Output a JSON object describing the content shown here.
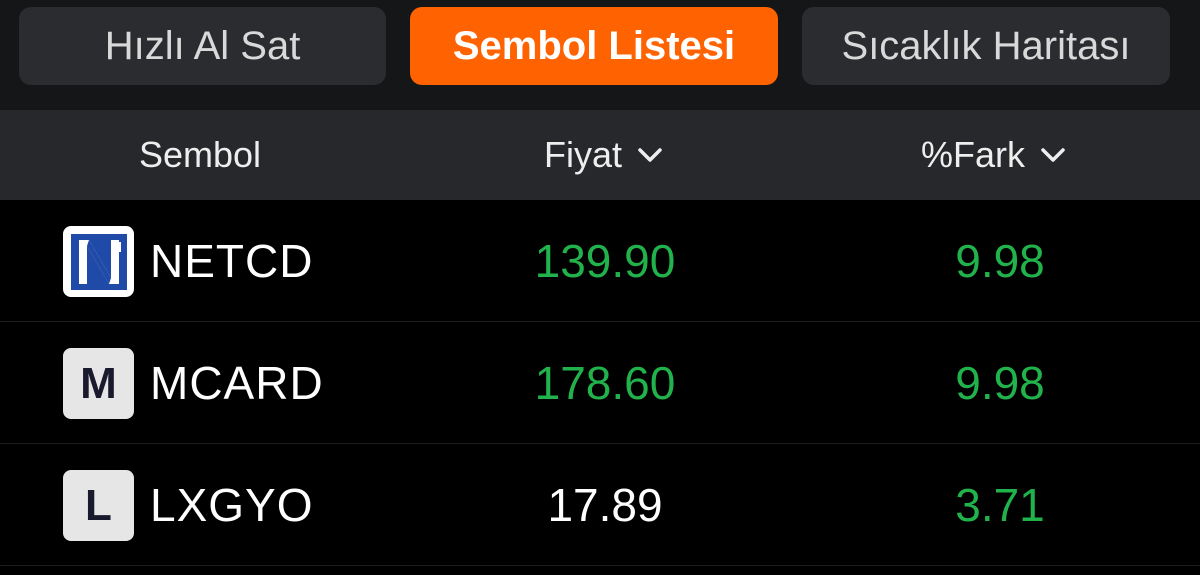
{
  "tabs": [
    {
      "label": "Hızlı Al Sat",
      "active": false
    },
    {
      "label": "Sembol Listesi",
      "active": true
    },
    {
      "label": "Sıcaklık Haritası",
      "active": false
    }
  ],
  "header": {
    "symbol": "Sembol",
    "price": "Fiyat",
    "diff": "%Fark",
    "sort_icon": "chevron-down-icon"
  },
  "rows": [
    {
      "logo": "netcd-logo",
      "logo_letter": "",
      "symbol": "NETCD",
      "price": "139.90",
      "diff": "9.98",
      "price_color": "#22b24c",
      "diff_color": "#22b24c"
    },
    {
      "logo": "m-logo",
      "logo_letter": "M",
      "symbol": "MCARD",
      "price": "178.60",
      "diff": "9.98",
      "price_color": "#22b24c",
      "diff_color": "#22b24c"
    },
    {
      "logo": "l-logo",
      "logo_letter": "L",
      "symbol": "LXGYO",
      "price": "17.89",
      "diff": "3.71",
      "price_color": "#ffffff",
      "diff_color": "#22b24c"
    }
  ],
  "colors": {
    "accent": "#ff6200",
    "positive": "#22b24c",
    "neutral": "#ffffff",
    "background": "#000000"
  }
}
